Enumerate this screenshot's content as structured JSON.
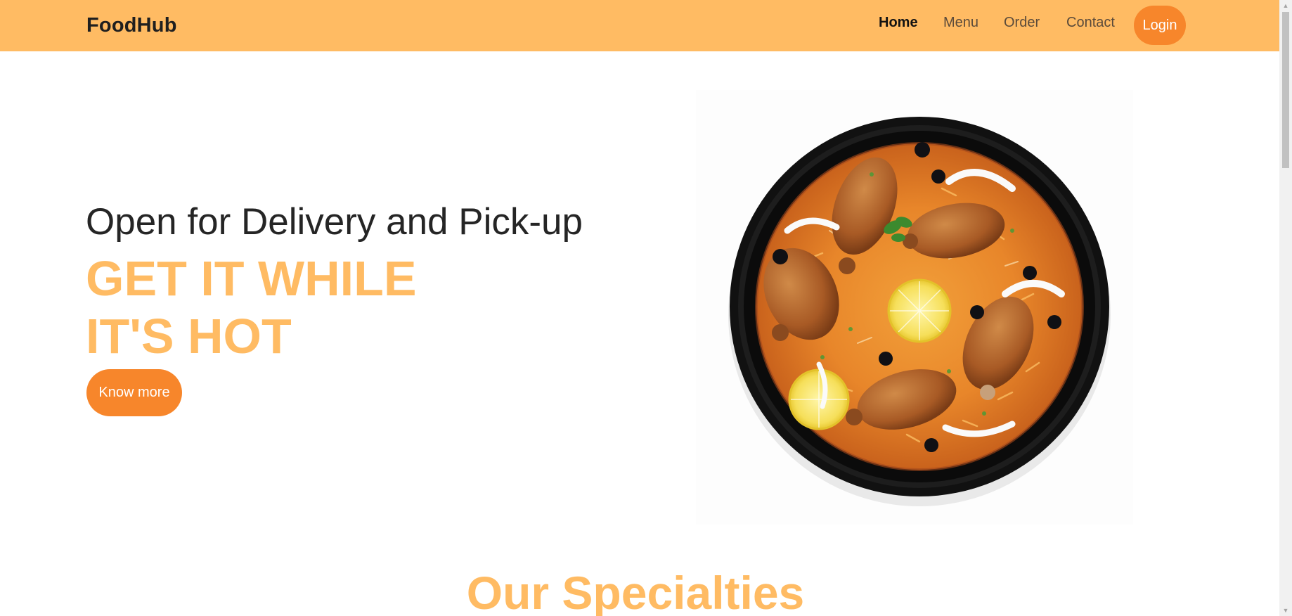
{
  "navbar": {
    "brand": "FoodHub",
    "links": [
      {
        "label": "Home",
        "active": true
      },
      {
        "label": "Menu",
        "active": false
      },
      {
        "label": "Order",
        "active": false
      },
      {
        "label": "Contact",
        "active": false
      }
    ],
    "login_label": "Login"
  },
  "hero": {
    "subtitle": "Open for Delivery and Pick-up",
    "title_line1": "GET IT WHILE",
    "title_line2": "IT'S HOT",
    "cta_label": "Know more"
  },
  "specialties": {
    "title": "Our Specialties"
  },
  "colors": {
    "navbar_bg": "#ffbb63",
    "accent": "#ffbb63",
    "button": "#f7862b"
  },
  "icons": {
    "scroll_up": "triangle-up-icon",
    "scroll_down": "triangle-down-icon"
  }
}
